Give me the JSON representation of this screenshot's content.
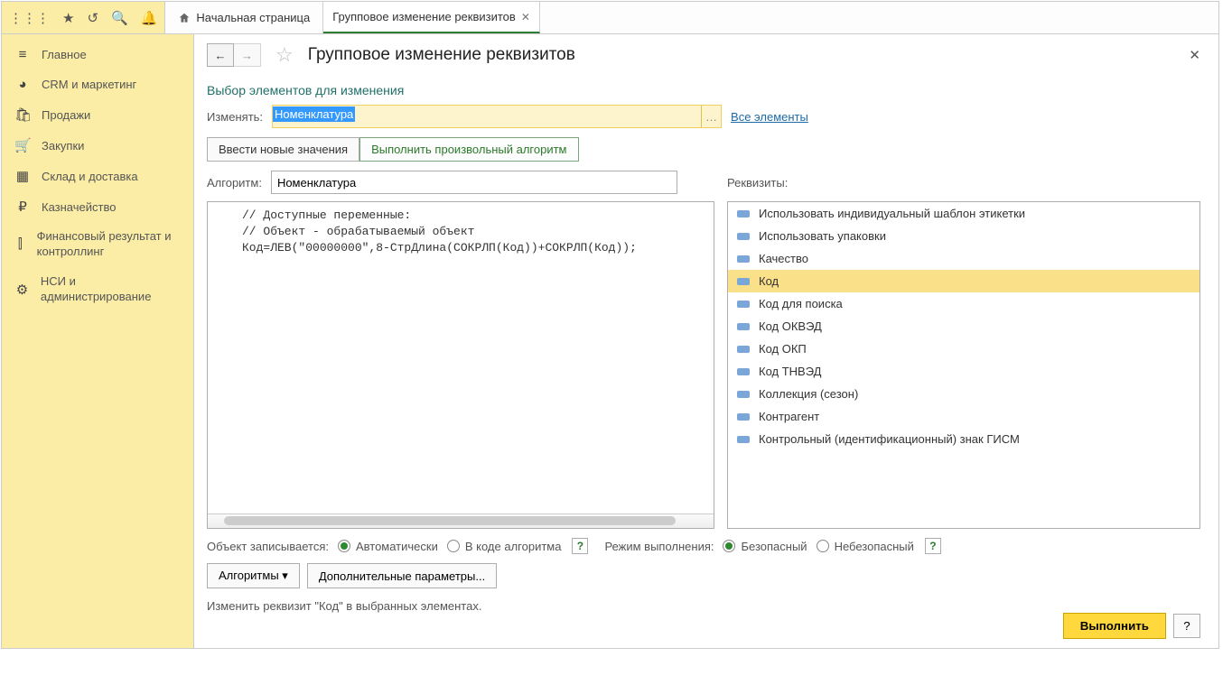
{
  "tabs": {
    "home": "Начальная страница",
    "active": "Групповое изменение реквизитов"
  },
  "sidebar": {
    "items": [
      {
        "icon": "≡",
        "label": "Главное"
      },
      {
        "icon": "◔",
        "label": "CRM и маркетинг"
      },
      {
        "icon": "🛍",
        "label": "Продажи"
      },
      {
        "icon": "🛒",
        "label": "Закупки"
      },
      {
        "icon": "▦",
        "label": "Склад и доставка"
      },
      {
        "icon": "₽",
        "label": "Казначейство"
      },
      {
        "icon": "⫾⫾",
        "label": "Финансовый результат и контроллинг"
      },
      {
        "icon": "⚙",
        "label": "НСИ и администрирование"
      }
    ]
  },
  "page": {
    "title": "Групповое изменение реквизитов",
    "section": "Выбор элементов для изменения",
    "change_label": "Изменять:",
    "change_value": "Номенклатура",
    "all_elements": "Все элементы",
    "tab_new": "Ввести новые значения",
    "tab_algo": "Выполнить произвольный алгоритм",
    "algo_label": "Алгоритм:",
    "algo_value": "Номенклатура",
    "req_label": "Реквизиты:",
    "code": [
      "// Доступные переменные:",
      "// Объект - обрабатываемый объект",
      "Код=ЛЕВ(\"00000000\",8-СтрДлина(СОКРЛП(Код))+СОКРЛП(Код));"
    ],
    "requisites": [
      "Использовать индивидуальный шаблон этикетки",
      "Использовать упаковки",
      "Качество",
      "Код",
      "Код для поиска",
      "Код ОКВЭД",
      "Код ОКП",
      "Код ТНВЭД",
      "Коллекция (сезон)",
      "Контрагент",
      "Контрольный (идентификационный) знак ГИСМ"
    ],
    "req_selected": "Код",
    "write_label": "Объект записывается:",
    "write_auto": "Автоматически",
    "write_code": "В коде алгоритма",
    "mode_label": "Режим выполнения:",
    "mode_safe": "Безопасный",
    "mode_unsafe": "Небезопасный",
    "menu_algo": "Алгоритмы",
    "menu_extra": "Дополнительные параметры...",
    "status": "Изменить реквизит \"Код\" в выбранных элементах.",
    "execute": "Выполнить"
  }
}
